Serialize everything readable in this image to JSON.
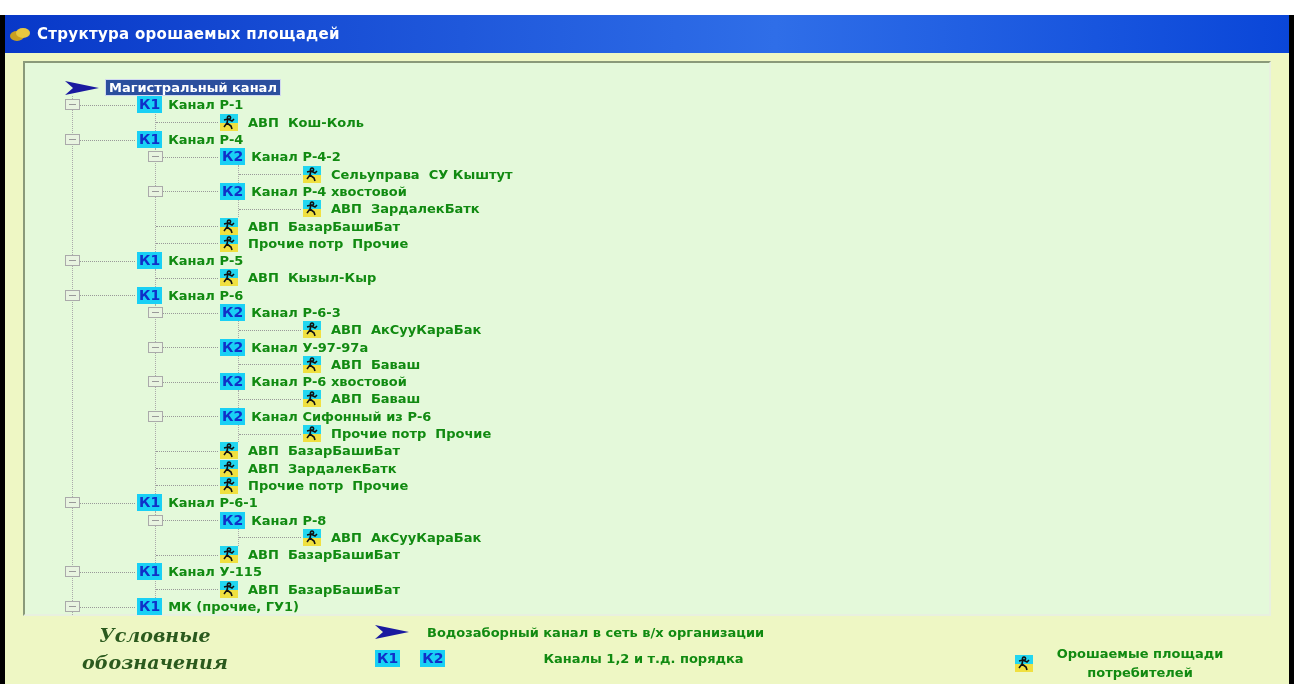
{
  "window": {
    "title": "Структура орошаемых площадей"
  },
  "tree": {
    "root": {
      "label": "Магистральный канал",
      "selected": true,
      "children": [
        {
          "kind": "channel",
          "badge": "К1",
          "label": "Канал Р-1",
          "expanded": true,
          "children": [
            {
              "kind": "area",
              "label": "АВП  Кош-Коль"
            }
          ]
        },
        {
          "kind": "channel",
          "badge": "К1",
          "label": "Канал Р-4",
          "expanded": true,
          "children": [
            {
              "kind": "channel",
              "badge": "К2",
              "label": "Канал Р-4-2",
              "expanded": true,
              "children": [
                {
                  "kind": "area",
                  "label": "Сельуправа  СУ Кыштут"
                }
              ]
            },
            {
              "kind": "channel",
              "badge": "К2",
              "label": "Канал Р-4 хвостовой",
              "expanded": true,
              "children": [
                {
                  "kind": "area",
                  "label": "АВП  ЗардалекБатк"
                }
              ]
            },
            {
              "kind": "area",
              "label": "АВП  БазарБашиБат"
            },
            {
              "kind": "area",
              "label": "Прочие потр  Прочие"
            }
          ]
        },
        {
          "kind": "channel",
          "badge": "К1",
          "label": "Канал Р-5",
          "expanded": true,
          "children": [
            {
              "kind": "area",
              "label": "АВП  Кызыл-Кыр"
            }
          ]
        },
        {
          "kind": "channel",
          "badge": "К1",
          "label": "Канал Р-6",
          "expanded": true,
          "children": [
            {
              "kind": "channel",
              "badge": "К2",
              "label": "Канал Р-6-3",
              "expanded": true,
              "children": [
                {
                  "kind": "area",
                  "label": "АВП  АкСууКараБак"
                }
              ]
            },
            {
              "kind": "channel",
              "badge": "К2",
              "label": "Канал У-97-97а",
              "expanded": true,
              "children": [
                {
                  "kind": "area",
                  "label": "АВП  Баваш"
                }
              ]
            },
            {
              "kind": "channel",
              "badge": "К2",
              "label": "Канал Р-6 хвостовой",
              "expanded": true,
              "children": [
                {
                  "kind": "area",
                  "label": "АВП  Баваш"
                }
              ]
            },
            {
              "kind": "channel",
              "badge": "К2",
              "label": "Канал Сифонный из Р-6",
              "expanded": true,
              "children": [
                {
                  "kind": "area",
                  "label": "Прочие потр  Прочие"
                }
              ]
            },
            {
              "kind": "area",
              "label": "АВП  БазарБашиБат"
            },
            {
              "kind": "area",
              "label": "АВП  ЗардалекБатк"
            },
            {
              "kind": "area",
              "label": "Прочие потр  Прочие"
            }
          ]
        },
        {
          "kind": "channel",
          "badge": "К1",
          "label": "Канал Р-6-1",
          "expanded": true,
          "children": [
            {
              "kind": "channel",
              "badge": "К2",
              "label": "Канал Р-8",
              "expanded": true,
              "children": [
                {
                  "kind": "area",
                  "label": "АВП  АкСууКараБак"
                }
              ]
            },
            {
              "kind": "area",
              "label": "АВП  БазарБашиБат"
            }
          ]
        },
        {
          "kind": "channel",
          "badge": "К1",
          "label": "Канал У-115",
          "expanded": true,
          "children": [
            {
              "kind": "area",
              "label": "АВП  БазарБашиБат"
            }
          ]
        },
        {
          "kind": "channel",
          "badge": "К1",
          "label": "МК (прочие, ГУ1)",
          "expanded": true
        }
      ]
    }
  },
  "legend": {
    "title": "Условные обозначения",
    "items": [
      {
        "kind": "arrow",
        "text": "Водозаборный канал в сеть в/х организации"
      },
      {
        "kind": "badges",
        "badges": [
          "К1",
          "К2"
        ],
        "text": "Каналы 1,2 и т.д. порядка"
      },
      {
        "kind": "area",
        "text": "Орошаемые площади потребителей"
      }
    ]
  }
}
